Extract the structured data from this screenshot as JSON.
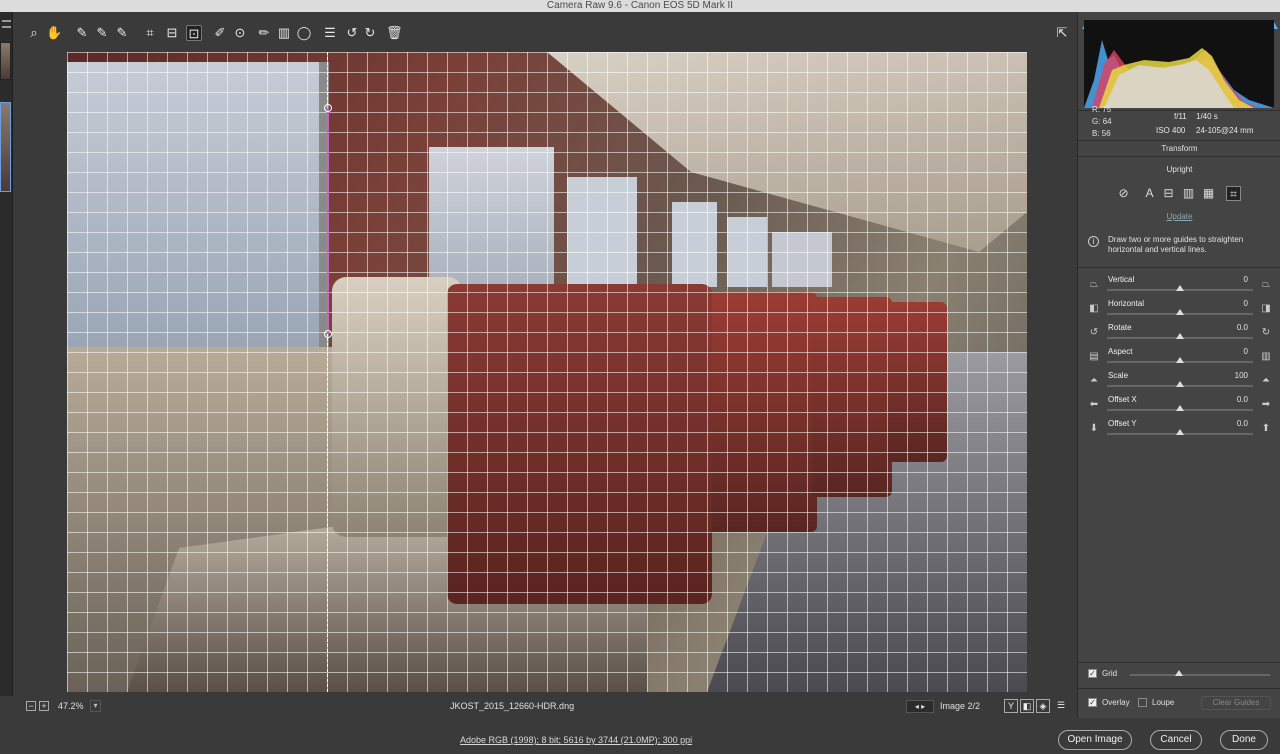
{
  "window": {
    "title": "Camera Raw 9.6  -  Canon EOS 5D Mark II"
  },
  "toolbar": {
    "tools": [
      "zoom-tool",
      "hand-tool",
      "white-balance-tool",
      "color-sampler-tool",
      "targeted-adjustment-tool",
      "crop-tool",
      "straighten-tool",
      "transform-tool",
      "spot-removal-tool",
      "red-eye-tool",
      "adjustment-brush",
      "graduated-filter",
      "radial-filter",
      "preferences",
      "rotate-ccw",
      "rotate-cw",
      "trash"
    ],
    "active_tool": "transform-tool",
    "glyphs": [
      "⌕",
      "✋",
      "✎",
      "✎",
      "✎",
      "⌗",
      "⊟",
      "⊡",
      "✐",
      "⊙",
      "✏",
      "▥",
      "◯",
      "☰",
      "↺",
      "↻",
      "🗑"
    ]
  },
  "status": {
    "zoom": "47.2%",
    "zoom_minus": "−",
    "zoom_plus": "+",
    "zoom_dropdown": "▾",
    "filename": "JKOST_2015_12660-HDR.dng",
    "image_counter": "Image 2/2",
    "prev": "◂",
    "next": "▸",
    "view_buttons": [
      "Y",
      "◧",
      "◈",
      "☰"
    ]
  },
  "readout": {
    "r_label": "R:",
    "r": "75",
    "g_label": "G:",
    "g": "64",
    "b_label": "B:",
    "b": "56",
    "aperture": "f/11",
    "shutter": "1/40 s",
    "iso": "ISO 400",
    "lens": "24-105@24 mm"
  },
  "transform": {
    "title": "Transform",
    "upright_label": "Upright",
    "upright_buttons": [
      "⊘",
      "A",
      "⊟",
      "▥",
      "▦",
      "⌗"
    ],
    "update_label": "Update",
    "info_icon": "i",
    "info_text": "Draw two or more guides to straighten horizontal and vertical lines.",
    "sliders": [
      {
        "label": "Vertical",
        "value": "0",
        "pos": 0.5,
        "icon_l": "⏢",
        "icon_r": "⏢"
      },
      {
        "label": "Horizontal",
        "value": "0",
        "pos": 0.5,
        "icon_l": "◧",
        "icon_r": "◨"
      },
      {
        "label": "Rotate",
        "value": "0.0",
        "pos": 0.5,
        "icon_l": "↺",
        "icon_r": "↻"
      },
      {
        "label": "Aspect",
        "value": "0",
        "pos": 0.5,
        "icon_l": "▤",
        "icon_r": "▥"
      },
      {
        "label": "Scale",
        "value": "100",
        "pos": 0.5,
        "icon_l": "⏶",
        "icon_r": "⏶"
      },
      {
        "label": "Offset X",
        "value": "0.0",
        "pos": 0.5,
        "icon_l": "⬅",
        "icon_r": "➡"
      },
      {
        "label": "Offset Y",
        "value": "0.0",
        "pos": 0.5,
        "icon_l": "⬇",
        "icon_r": "⬆"
      }
    ],
    "grid_label": "Grid",
    "grid_checked": "✓",
    "grid_slider_pos": 0.35,
    "overlay_label": "Overlay",
    "overlay_checked": "✓",
    "loupe_label": "Loupe",
    "clear_guides": "Clear Guides"
  },
  "footer": {
    "workflow": "Adobe RGB (1998); 8 bit; 5616 by 3744 (21.0MP); 300 ppi",
    "open_image": "Open Image",
    "cancel": "Cancel",
    "done": "Done"
  }
}
